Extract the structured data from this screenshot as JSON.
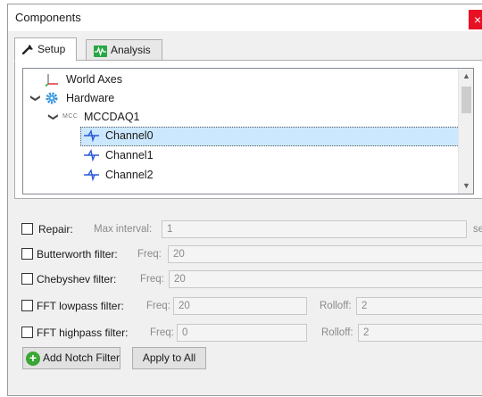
{
  "window": {
    "title": "Components",
    "close_glyph": "×"
  },
  "tabs": [
    {
      "label": "Setup",
      "icon": "wrench-icon",
      "active": true
    },
    {
      "label": "Analysis",
      "icon": "waveform-icon",
      "active": false
    }
  ],
  "tree": {
    "items": [
      {
        "label": "World Axes",
        "icon": "axes-icon",
        "expanded": null
      },
      {
        "label": "Hardware",
        "icon": "gear-icon",
        "expanded": true
      },
      {
        "label": "MCCDAQ1",
        "icon": "mcc-logo-icon",
        "icon_text": "MCC",
        "expanded": true
      },
      {
        "label": "Channel0",
        "icon": "channel-icon",
        "selected": true
      },
      {
        "label": "Channel1",
        "icon": "channel-icon"
      },
      {
        "label": "Channel2",
        "icon": "channel-icon"
      }
    ],
    "chevron_glyph": "❯",
    "scroll_up_glyph": "▲",
    "scroll_down_glyph": "▼"
  },
  "filters": {
    "repair": {
      "label": "Repair:",
      "sub": "Max interval:",
      "value": "1",
      "unit": "sec"
    },
    "butterworth": {
      "label": "Butterworth filter:",
      "sub": "Freq:",
      "value": "20"
    },
    "chebyshev": {
      "label": "Chebyshev filter:",
      "sub": "Freq:",
      "value": "20"
    },
    "fft_lowpass": {
      "label": "FFT lowpass filter:",
      "sub": "Freq:",
      "value": "20",
      "rolloff_label": "Rolloff:",
      "rolloff_value": "2"
    },
    "fft_highpass": {
      "label": "FFT highpass filter:",
      "sub": "Freq:",
      "value": "0",
      "rolloff_label": "Rolloff:",
      "rolloff_value": "2"
    }
  },
  "buttons": {
    "add_notch": "Add Notch Filter",
    "apply_all": "Apply to All"
  },
  "colors": {
    "selection": "#cce8ff",
    "close": "#e81123",
    "channel_icon": "#2b5bd6",
    "add_icon": "#3aa635"
  }
}
